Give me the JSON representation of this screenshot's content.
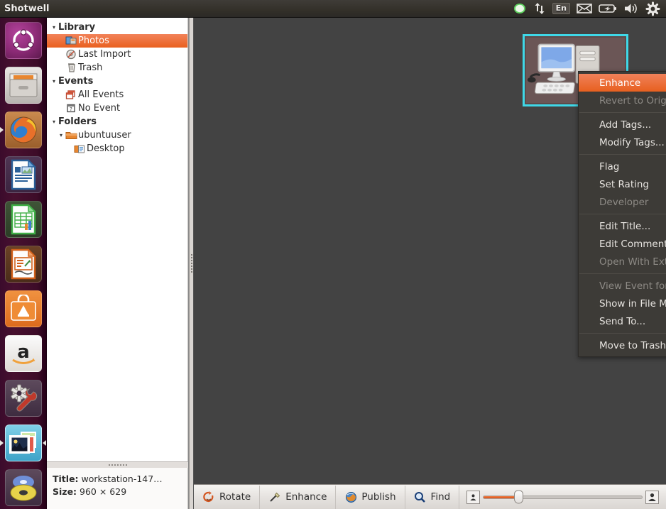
{
  "window": {
    "title": "Shotwell"
  },
  "top_panel": {
    "tray_items": [
      {
        "name": "ubuntuone-sync-icon",
        "label": ""
      },
      {
        "name": "network-updown-icon",
        "label": ""
      },
      {
        "name": "keyboard-layout-indicator",
        "label": "En"
      },
      {
        "name": "messaging-envelope-icon",
        "label": ""
      },
      {
        "name": "battery-icon",
        "label": ""
      },
      {
        "name": "volume-icon",
        "label": ""
      },
      {
        "name": "system-gear-icon",
        "label": ""
      }
    ]
  },
  "launcher": {
    "items": [
      {
        "name": "launcher-item-dash",
        "label": "Ubuntu Dash home"
      },
      {
        "name": "launcher-item-files",
        "label": "Files"
      },
      {
        "name": "launcher-item-firefox",
        "label": "Firefox Web Browser"
      },
      {
        "name": "launcher-item-libreoffice-writer",
        "label": "LibreOffice Writer"
      },
      {
        "name": "launcher-item-libreoffice-calc",
        "label": "LibreOffice Calc"
      },
      {
        "name": "launcher-item-libreoffice-impress",
        "label": "LibreOffice Impress"
      },
      {
        "name": "launcher-item-software-center",
        "label": "Ubuntu Software Center"
      },
      {
        "name": "launcher-item-amazon",
        "label": "Amazon"
      },
      {
        "name": "launcher-item-system-settings",
        "label": "System Settings"
      },
      {
        "name": "launcher-item-shotwell",
        "label": "Shotwell Photo Manager"
      },
      {
        "name": "launcher-item-rhythmbox",
        "label": "Rhythmbox"
      }
    ]
  },
  "sidebar": {
    "tree": [
      {
        "label": "Library",
        "level": 0,
        "type": "group",
        "twisty": "▾",
        "icon": "",
        "selected": false
      },
      {
        "label": "Photos",
        "level": 1,
        "type": "item",
        "twisty": "",
        "icon": "photos-icon",
        "selected": true
      },
      {
        "label": "Last Import",
        "level": 1,
        "type": "item",
        "twisty": "",
        "icon": "last-import-icon",
        "selected": false
      },
      {
        "label": "Trash",
        "level": 1,
        "type": "item",
        "twisty": "",
        "icon": "trash-icon",
        "selected": false
      },
      {
        "label": "Events",
        "level": 0,
        "type": "group",
        "twisty": "▾",
        "icon": "",
        "selected": false
      },
      {
        "label": "All Events",
        "level": 1,
        "type": "item",
        "twisty": "",
        "icon": "all-events-icon",
        "selected": false
      },
      {
        "label": "No Event",
        "level": 1,
        "type": "item",
        "twisty": "",
        "icon": "no-event-icon",
        "selected": false
      },
      {
        "label": "Folders",
        "level": 0,
        "type": "group",
        "twisty": "▾",
        "icon": "",
        "selected": false
      },
      {
        "label": "ubuntuuser",
        "level": 1,
        "type": "folder",
        "twisty": "▾",
        "icon": "folder-icon",
        "selected": false
      },
      {
        "label": "Desktop",
        "level": 2,
        "type": "folder",
        "twisty": "",
        "icon": "desktop-folder-icon",
        "selected": false
      }
    ],
    "info": {
      "title_label": "Title:",
      "title_value": "workstation-147…",
      "size_label": "Size:",
      "size_value": "960 × 629"
    }
  },
  "context_menu": {
    "items": [
      {
        "label": "Enhance",
        "state": "selected",
        "submenu": false,
        "separator_after": false
      },
      {
        "label": "Revert to Original",
        "state": "disabled",
        "submenu": false,
        "separator_after": true
      },
      {
        "label": "Add Tags...",
        "state": "normal",
        "submenu": false,
        "separator_after": false
      },
      {
        "label": "Modify Tags...",
        "state": "normal",
        "submenu": false,
        "separator_after": true
      },
      {
        "label": "Flag",
        "state": "normal",
        "submenu": false,
        "separator_after": false
      },
      {
        "label": "Set Rating",
        "state": "normal",
        "submenu": true,
        "separator_after": false
      },
      {
        "label": "Developer",
        "state": "disabled",
        "submenu": true,
        "separator_after": true
      },
      {
        "label": "Edit Title...",
        "state": "normal",
        "submenu": false,
        "separator_after": false
      },
      {
        "label": "Edit Comment...",
        "state": "normal",
        "submenu": false,
        "separator_after": false
      },
      {
        "label": "Open With External Editor",
        "state": "disabled",
        "submenu": false,
        "separator_after": true
      },
      {
        "label": "View Event for Photo",
        "state": "disabled",
        "submenu": false,
        "separator_after": false
      },
      {
        "label": "Show in File Manager",
        "state": "normal",
        "submenu": false,
        "separator_after": false
      },
      {
        "label": "Send To...",
        "state": "normal",
        "submenu": false,
        "separator_after": true
      },
      {
        "label": "Move to Trash",
        "state": "normal",
        "submenu": false,
        "separator_after": false
      }
    ],
    "submenu_arrow": "›"
  },
  "photo": {
    "selected": true,
    "alt": "workstation computer photo thumbnail"
  },
  "toolbar": {
    "buttons": [
      {
        "label": "Rotate",
        "icon": "rotate-icon"
      },
      {
        "label": "Enhance",
        "icon": "enhance-wand-icon"
      },
      {
        "label": "Publish",
        "icon": "publish-globe-icon"
      },
      {
        "label": "Find",
        "icon": "find-magnifier-icon"
      }
    ],
    "zoom": {
      "value_percent": 22,
      "min_icon": "zoom-out-small-icon",
      "max_icon": "zoom-in-large-icon"
    }
  },
  "colors": {
    "accent_orange": "#e7601f",
    "selection_cyan": "#3fd8e8",
    "canvas_gray": "#434343",
    "menu_bg": "#3d3b37",
    "launcher_purple": "#47102f"
  }
}
